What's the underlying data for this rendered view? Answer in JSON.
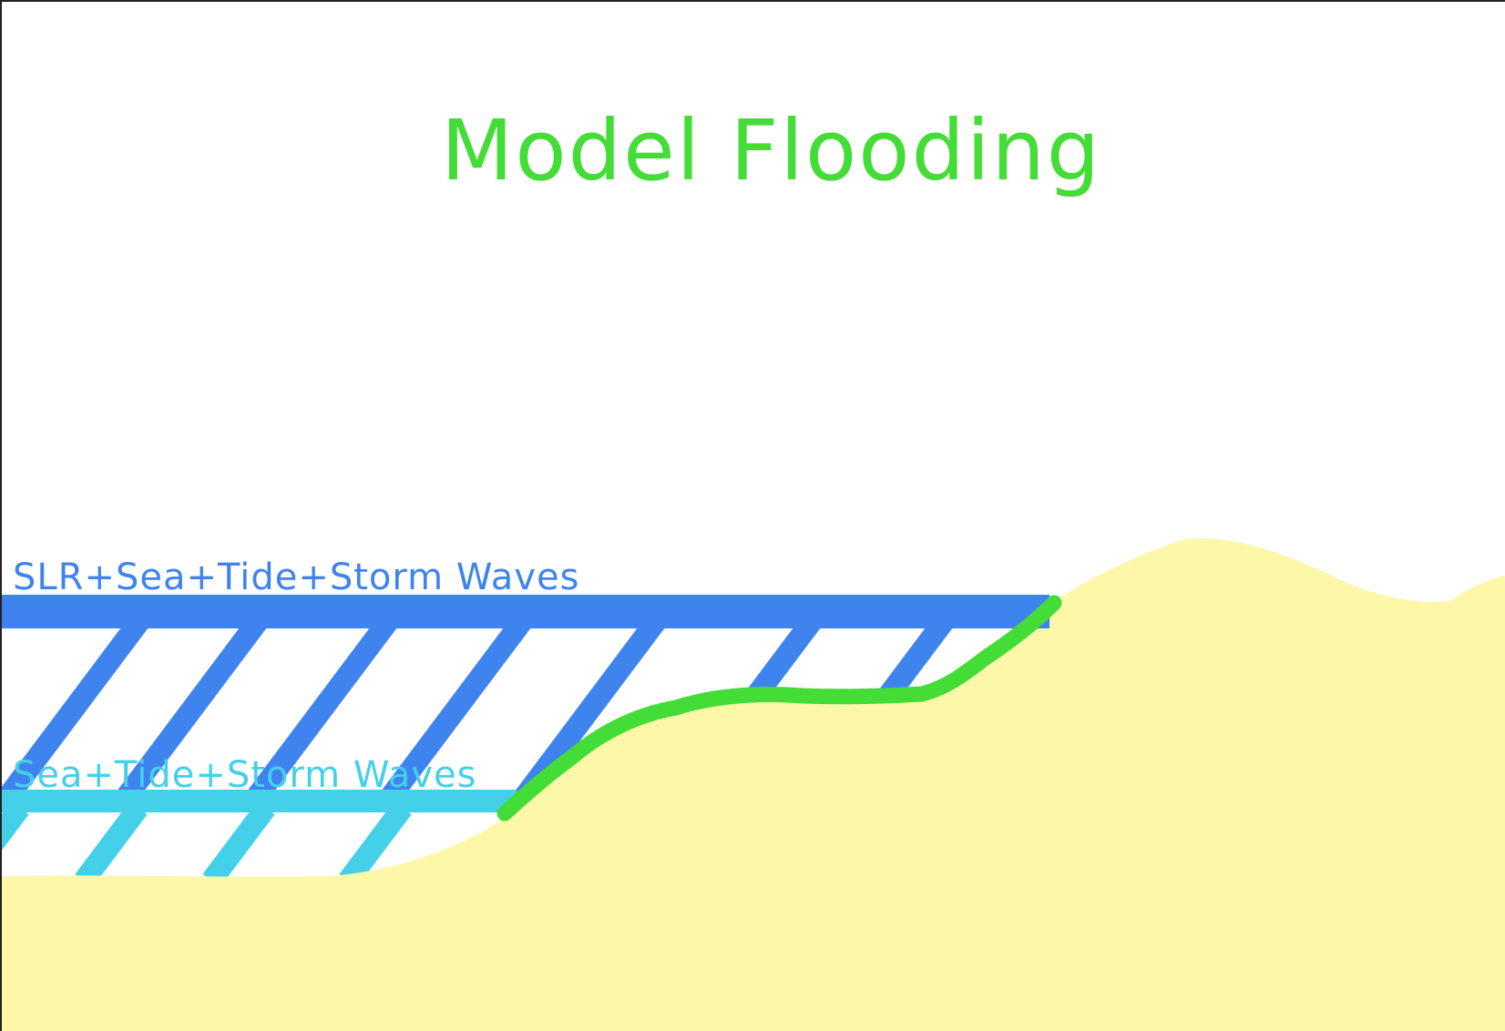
{
  "title": "Model Flooding",
  "levels": {
    "upper": {
      "label": "SLR+Sea+Tide+Storm Waves",
      "color": "#3f83ef"
    },
    "lower": {
      "label": "Sea+Tide+Storm Waves",
      "color": "#45d0ea"
    }
  },
  "colors": {
    "title": "#44dc36",
    "sand": "#fdf7a8",
    "shoreline": "#44dc36",
    "border": "#222222"
  }
}
